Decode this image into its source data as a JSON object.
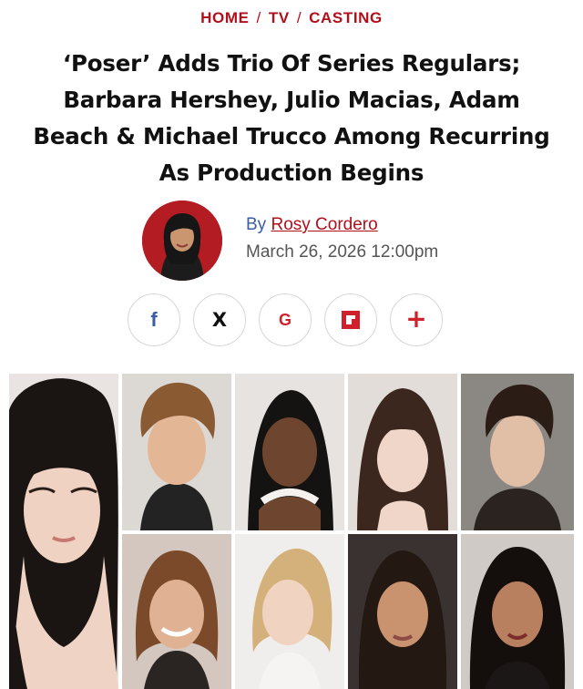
{
  "breadcrumb": {
    "home": "HOME",
    "tv": "TV",
    "casting": "CASTING",
    "separator": "/"
  },
  "headline": {
    "line1": "‘Poser’ Adds Trio Of Series Regulars;",
    "line2": "Barbara Hershey, Julio Macias, Adam",
    "line3": "Beach & Michael Trucco Among Recurring",
    "line4": "As Production Begins"
  },
  "author": {
    "by": "By",
    "name": "Rosy Cordero",
    "date": "March 26, 2026 12:00pm"
  },
  "share": {
    "facebook": "f",
    "x": "X",
    "google": "G",
    "plus": "+",
    "icons": [
      "facebook-icon",
      "x-icon",
      "google-icon",
      "flipboard-icon",
      "plus-icon"
    ]
  },
  "colors": {
    "accent": "#b1101b",
    "byline": "#3a5da8",
    "avatar_bg": "#b31c22"
  }
}
